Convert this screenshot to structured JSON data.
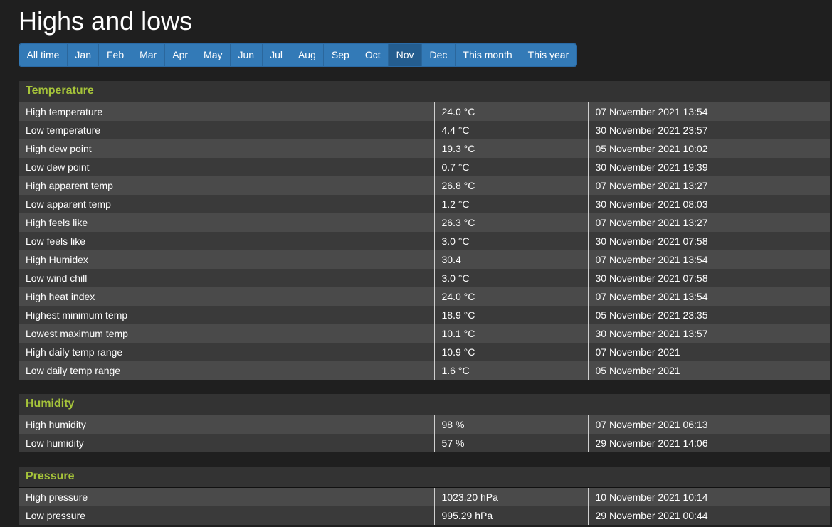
{
  "title": "Highs and lows",
  "tabs": [
    {
      "label": "All time"
    },
    {
      "label": "Jan"
    },
    {
      "label": "Feb"
    },
    {
      "label": "Mar"
    },
    {
      "label": "Apr"
    },
    {
      "label": "May"
    },
    {
      "label": "Jun"
    },
    {
      "label": "Jul"
    },
    {
      "label": "Aug"
    },
    {
      "label": "Sep"
    },
    {
      "label": "Oct"
    },
    {
      "label": "Nov"
    },
    {
      "label": "Dec"
    },
    {
      "label": "This month"
    },
    {
      "label": "This year"
    }
  ],
  "active_tab": "Nov",
  "sections": {
    "temperature": {
      "title": "Temperature",
      "rows": [
        {
          "label": "High temperature",
          "value": "24.0 °C",
          "when": "07 November 2021 13:54"
        },
        {
          "label": "Low temperature",
          "value": "4.4 °C",
          "when": "30 November 2021 23:57"
        },
        {
          "label": "High dew point",
          "value": "19.3 °C",
          "when": "05 November 2021 10:02"
        },
        {
          "label": "Low dew point",
          "value": "0.7 °C",
          "when": "30 November 2021 19:39"
        },
        {
          "label": "High apparent temp",
          "value": "26.8 °C",
          "when": "07 November 2021 13:27"
        },
        {
          "label": "Low apparent temp",
          "value": "1.2 °C",
          "when": "30 November 2021 08:03"
        },
        {
          "label": "High feels like",
          "value": "26.3 °C",
          "when": "07 November 2021 13:27"
        },
        {
          "label": "Low feels like",
          "value": "3.0 °C",
          "when": "30 November 2021 07:58"
        },
        {
          "label": "High Humidex",
          "value": "30.4",
          "when": "07 November 2021 13:54"
        },
        {
          "label": "Low wind chill",
          "value": "3.0 °C",
          "when": "30 November 2021 07:58"
        },
        {
          "label": "High heat index",
          "value": "24.0 °C",
          "when": "07 November 2021 13:54"
        },
        {
          "label": "Highest minimum temp",
          "value": "18.9 °C",
          "when": "05 November 2021 23:35"
        },
        {
          "label": "Lowest maximum temp",
          "value": "10.1 °C",
          "when": "30 November 2021 13:57"
        },
        {
          "label": "High daily temp range",
          "value": "10.9 °C",
          "when": "07 November 2021"
        },
        {
          "label": "Low daily temp range",
          "value": "1.6 °C",
          "when": "05 November 2021"
        }
      ]
    },
    "humidity": {
      "title": "Humidity",
      "rows": [
        {
          "label": "High humidity",
          "value": "98 %",
          "when": "07 November 2021 06:13"
        },
        {
          "label": "Low humidity",
          "value": "57 %",
          "when": "29 November 2021 14:06"
        }
      ]
    },
    "pressure": {
      "title": "Pressure",
      "rows": [
        {
          "label": "High pressure",
          "value": "1023.20 hPa",
          "when": "10 November 2021 10:14"
        },
        {
          "label": "Low pressure",
          "value": "995.29 hPa",
          "when": "29 November 2021 00:44"
        }
      ]
    }
  },
  "colors": {
    "background": "#1f1f1f",
    "tab": "#337ab7",
    "tab_active": "#245d8f",
    "section_title": "#a6c43a",
    "row_odd": "#4a4a4a",
    "row_even": "#3a3a3a"
  }
}
